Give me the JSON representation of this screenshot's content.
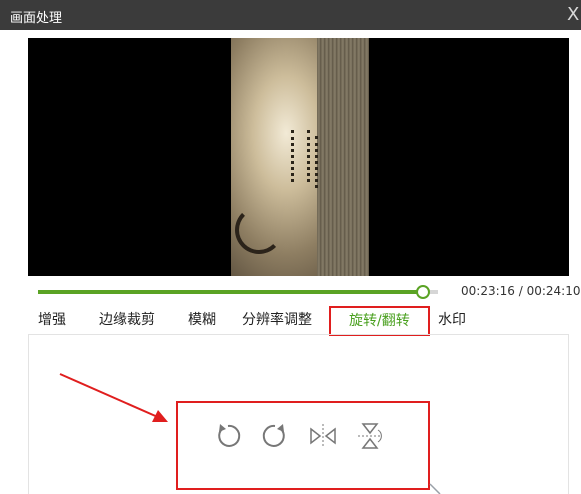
{
  "window": {
    "title": "画面处理",
    "close_icon": "close-icon",
    "close_glyph": "X"
  },
  "player": {
    "current_time": "00:23:16",
    "total_time": "00:24:10",
    "time_display": "00:23:16 / 00:24:10",
    "progress_fraction": 0.963,
    "accent_color": "#5aa324"
  },
  "tabs": [
    {
      "label": "增强",
      "active": false
    },
    {
      "label": "边缘裁剪",
      "active": false
    },
    {
      "label": "模糊",
      "active": false
    },
    {
      "label": "分辨率调整",
      "active": false
    },
    {
      "label": "旋转/翻转",
      "active": true
    },
    {
      "label": "水印",
      "active": false
    }
  ],
  "rotate_tools": [
    {
      "name": "rotate-counterclockwise-icon"
    },
    {
      "name": "rotate-clockwise-icon"
    },
    {
      "name": "flip-horizontal-icon"
    },
    {
      "name": "flip-vertical-icon"
    }
  ],
  "annotation": {
    "highlight_color": "#e01e1e"
  }
}
